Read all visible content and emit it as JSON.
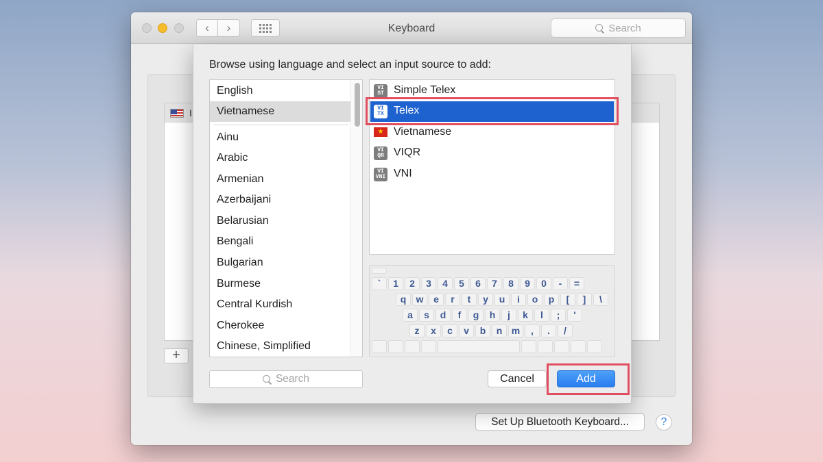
{
  "window": {
    "title": "Keyboard",
    "search_placeholder": "Search",
    "nav_back_glyph": "‹",
    "nav_fwd_glyph": "›",
    "plus_label": "+",
    "bluetooth_button": "Set Up Bluetooth Keyboard...",
    "help_label": "?",
    "bg_row_label": "I"
  },
  "sheet": {
    "prompt": "Browse using language and select an input source to add:",
    "languages": [
      "English",
      "Vietnamese",
      "Ainu",
      "Arabic",
      "Armenian",
      "Azerbaijani",
      "Belarusian",
      "Bengali",
      "Bulgarian",
      "Burmese",
      "Central Kurdish",
      "Cherokee",
      "Chinese, Simplified"
    ],
    "selected_language": "Vietnamese",
    "sources": [
      {
        "label": "Simple Telex",
        "icon": "VI ST"
      },
      {
        "label": "Telex",
        "icon": "VI TX",
        "selected": true
      },
      {
        "label": "Vietnamese",
        "icon": "vietnam-flag"
      },
      {
        "label": "VIQR",
        "icon": "VI QR"
      },
      {
        "label": "VNI",
        "icon": "VI VNI"
      }
    ],
    "keyboard_rows": [
      [
        "`",
        "1",
        "2",
        "3",
        "4",
        "5",
        "6",
        "7",
        "8",
        "9",
        "0",
        "-",
        "="
      ],
      [
        "q",
        "w",
        "e",
        "r",
        "t",
        "y",
        "u",
        "i",
        "o",
        "p",
        "[",
        "]",
        "\\"
      ],
      [
        "a",
        "s",
        "d",
        "f",
        "g",
        "h",
        "j",
        "k",
        "l",
        ";",
        "'"
      ],
      [
        "z",
        "x",
        "c",
        "v",
        "b",
        "n",
        "m",
        ",",
        ".",
        "/"
      ]
    ],
    "search_placeholder": "Search",
    "cancel_label": "Cancel",
    "add_label": "Add"
  },
  "colors": {
    "selection_blue": "#1e62d0",
    "highlight_red": "#e04f5f",
    "key_text": "#3f5a93"
  }
}
